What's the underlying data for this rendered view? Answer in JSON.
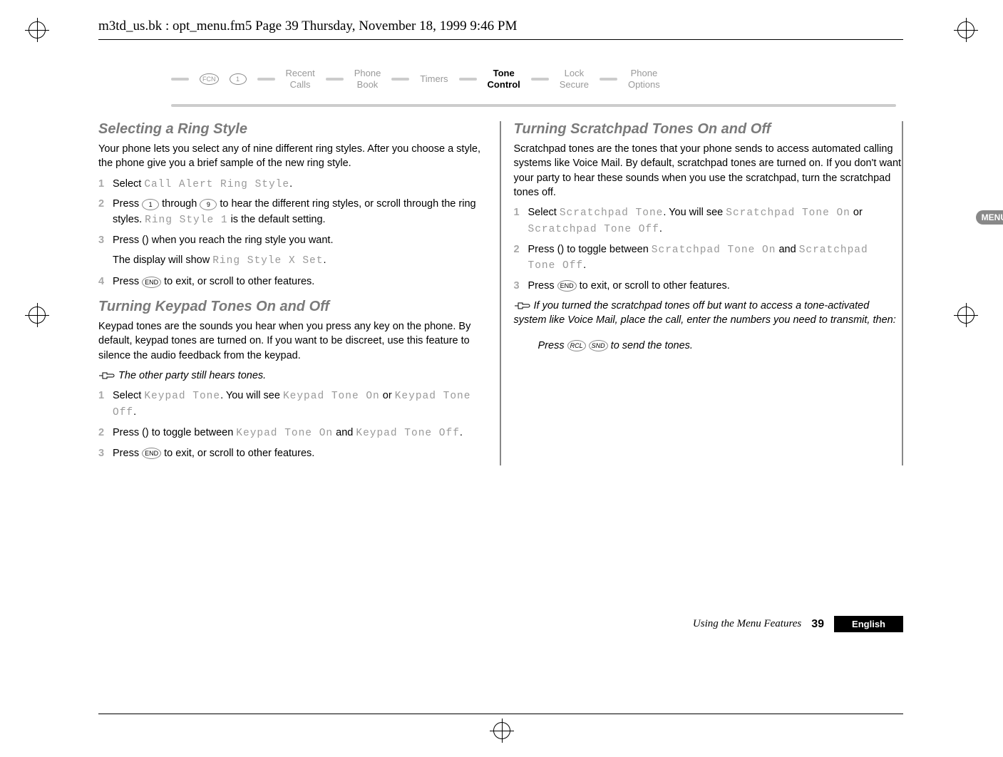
{
  "header": "m3td_us.bk : opt_menu.fm5  Page 39  Thursday, November 18, 1999  9:46 PM",
  "nav": {
    "fcn": "FCN",
    "one": "1",
    "items": [
      {
        "line1": "Recent",
        "line2": "Calls"
      },
      {
        "line1": "Phone",
        "line2": "Book"
      },
      {
        "line1": "Timers",
        "line2": ""
      },
      {
        "line1": "Tone",
        "line2": "Control",
        "active": true
      },
      {
        "line1": "Lock",
        "line2": "Secure"
      },
      {
        "line1": "Phone",
        "line2": "Options"
      }
    ]
  },
  "menu_tab": "MENU",
  "sections": {
    "left": {
      "title1": "Selecting a Ring Style",
      "intro1": "Your phone lets you select any of nine different ring styles. After you choose a style, the phone give you a brief sample of the new ring style.",
      "list1_1a": "Select ",
      "list1_1b": "Call Alert Ring Style",
      "list1_1c": ".",
      "list1_2a": "Press ",
      "list1_2b": " through ",
      "list1_2c": " to hear the different ring styles, or scroll through the ring styles. ",
      "list1_2d": "Ring Style 1",
      "list1_2e": " is the default setting.",
      "list1_3": "Press () when you reach the ring style you want.",
      "list1_3_cont_a": "The display will show ",
      "list1_3_cont_b": "Ring Style X Set",
      "list1_3_cont_c": ".",
      "list1_4a": "Press ",
      "list1_4b": " to exit, or scroll to other features.",
      "title2": "Turning Keypad Tones On and Off",
      "intro2": "Keypad tones are the sounds you hear when you press any key on the phone. By default, keypad tones are turned on. If you want to be discreet, use this feature to silence the audio feedback from the keypad.",
      "note2": "The other party still hears tones.",
      "list2_1a": "Select ",
      "list2_1b": "Keypad Tone",
      "list2_1c": ". You will see ",
      "list2_1d": "Keypad Tone On",
      "list2_1e": " or ",
      "list2_1f": "Keypad Tone Off",
      "list2_1g": ".",
      "list2_2a": "Press () to toggle between ",
      "list2_2b": "Keypad Tone On",
      "list2_2c": " and ",
      "list2_2d": "Keypad Tone Off",
      "list2_2e": ".",
      "list2_3a": "Press ",
      "list2_3b": " to exit, or scroll to other features."
    },
    "right": {
      "title1": "Turning Scratchpad Tones On and Off",
      "intro1": "Scratchpad tones are the tones that your phone sends to access automated calling systems like Voice Mail. By default, scratchpad tones are turned on. If you don't want your party to hear these sounds when you use the scratchpad, turn the scratchpad tones off.",
      "list1_1a": "Select ",
      "list1_1b": "Scratchpad Tone",
      "list1_1c": ". You will see ",
      "list1_1d": "Scratchpad Tone On",
      "list1_1e": " or ",
      "list1_1f": "Scratchpad Tone Off",
      "list1_1g": ".",
      "list1_2a": "Press () to toggle between ",
      "list1_2b": "Scratchpad Tone On",
      "list1_2c": " and ",
      "list1_2d": "Scratchpad Tone Off",
      "list1_2e": ".",
      "list1_3a": "Press ",
      "list1_3b": " to exit, or scroll to other features.",
      "note1": "If you turned the scratchpad tones off but want to access a tone-activated system like Voice Mail, place the call, enter the numbers you need to transmit, then:",
      "note1_press_a": "Press ",
      "note1_press_b": " ",
      "note1_press_c": " to send the tones."
    }
  },
  "keys": {
    "one": "1",
    "nine": "9",
    "end": "END",
    "rcl": "RCL",
    "snd": "SND"
  },
  "nums": {
    "1": "1",
    "2": "2",
    "3": "3",
    "4": "4"
  },
  "footer": {
    "section": "Using the Menu Features",
    "page": "39",
    "lang": "English"
  }
}
